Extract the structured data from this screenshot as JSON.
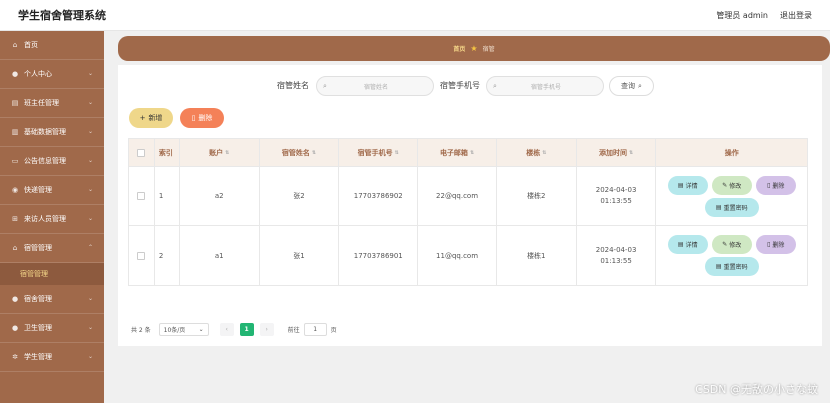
{
  "header": {
    "title": "学生宿舍管理系统",
    "user": "管理员 admin",
    "logout": "退出登录"
  },
  "sidebar": {
    "items": [
      {
        "label": "首页",
        "icon": "home-icon"
      },
      {
        "label": "个人中心",
        "icon": "user-icon"
      },
      {
        "label": "班主任管理",
        "icon": "list-icon"
      },
      {
        "label": "基础数据管理",
        "icon": "data-icon"
      },
      {
        "label": "公告信息管理",
        "icon": "notice-icon"
      },
      {
        "label": "快递管理",
        "icon": "parcel-icon"
      },
      {
        "label": "来访人员管理",
        "icon": "grid-icon"
      },
      {
        "label": "宿管管理",
        "icon": "house-icon"
      },
      {
        "label": "宿舍管理",
        "icon": "user-icon"
      },
      {
        "label": "卫生管理",
        "icon": "user-icon"
      },
      {
        "label": "学生管理",
        "icon": "gear-icon"
      }
    ],
    "active_sub": "宿管管理"
  },
  "breadcrumb": {
    "home": "首页",
    "current": "宿管"
  },
  "search": {
    "name_label": "宿管姓名",
    "name_placeholder": "宿管姓名",
    "phone_label": "宿管手机号",
    "phone_placeholder": "宿管手机号",
    "query": "查询"
  },
  "actions": {
    "add": "新增",
    "delete": "删除"
  },
  "table": {
    "columns": [
      "",
      "索引",
      "账户",
      "宿管姓名",
      "宿管手机号",
      "电子邮箱",
      "楼栋",
      "添加时间",
      "操作"
    ],
    "rows": [
      {
        "index": "1",
        "account": "a2",
        "name": "张2",
        "phone": "17703786902",
        "email": "22@qq.com",
        "building": "楼栋2",
        "time": "2024-04-03 01:13:55"
      },
      {
        "index": "2",
        "account": "a1",
        "name": "张1",
        "phone": "17703786901",
        "email": "11@qq.com",
        "building": "楼栋1",
        "time": "2024-04-03 01:13:55"
      }
    ],
    "ops": {
      "detail": "详情",
      "edit": "修改",
      "delete": "删除",
      "reset": "重置密码"
    }
  },
  "pagination": {
    "total": "共 2 条",
    "page_size": "10条/页",
    "current": "1",
    "goto": "前往",
    "goto_value": "1",
    "unit": "页"
  },
  "watermark": "CSDN @无敌の小さな蚊",
  "colors": {
    "sidebar": "#a0694a",
    "add_button": "#efd78a",
    "delete_button": "#f48158",
    "current_page": "#22b573"
  }
}
